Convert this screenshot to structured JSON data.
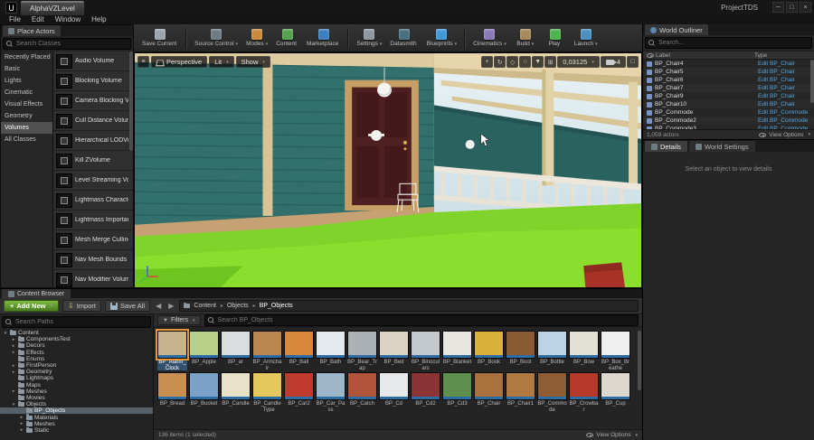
{
  "ui": {
    "caret_down": "▾",
    "crumb_sep": "▸",
    "menu_glyph": "≡",
    "close_glyph": "×",
    "min_glyph": "─",
    "max_glyph": "□",
    "back_glyph": "◀",
    "fwd_glyph": "▶",
    "plus_glyph": "+",
    "import_glyph": "⇩",
    "filter_glyph": "▼"
  },
  "window": {
    "logo": "U",
    "tab": "AlphaVZLevel",
    "title": "ProjectTDS",
    "menu": [
      "File",
      "Edit",
      "Window",
      "Help"
    ]
  },
  "place_actors": {
    "title": "Place Actors",
    "search_placeholder": "Search Classes",
    "categories": [
      "Recently Placed",
      "Basic",
      "Lights",
      "Cinematic",
      "Visual Effects",
      "Geometry",
      "Volumes",
      "All Classes"
    ],
    "selected_index": 6,
    "items": [
      "Audio Volume",
      "Blocking Volume",
      "Camera Blocking Vol",
      "Cull Distance Volume",
      "Hierarchical LODVol",
      "Kill ZVolume",
      "Level Streaming Vol",
      "Lightmass Character",
      "Lightmass Importan",
      "Mesh Merge Culling",
      "Nav Mesh Bounds V",
      "Nav Modifier Volume"
    ]
  },
  "toolbar": {
    "buttons": [
      {
        "label": "Save Current",
        "color": "#9aa5ad",
        "caret": ""
      },
      {
        "label": "Source Control",
        "color": "#6e7b84",
        "caret": "▾"
      },
      {
        "label": "Modes",
        "color": "#c98a3d",
        "caret": "▾"
      },
      {
        "label": "Content",
        "color": "#57a04e",
        "caret": ""
      },
      {
        "label": "Marketplace",
        "color": "#3e7fc1",
        "caret": ""
      },
      {
        "label": "Settings",
        "color": "#8f979e",
        "caret": "▾"
      },
      {
        "label": "Datasmith",
        "color": "#49707e",
        "caret": ""
      },
      {
        "label": "Blueprints",
        "color": "#3f9bd8",
        "caret": "▾"
      },
      {
        "label": "Cinematics",
        "color": "#8a7ab8",
        "caret": "▾"
      },
      {
        "label": "Build",
        "color": "#a68a5b",
        "caret": "▾"
      },
      {
        "label": "Play",
        "color": "#4fb34f",
        "caret": ""
      },
      {
        "label": "Launch",
        "color": "#4a90c0",
        "caret": "▾"
      }
    ]
  },
  "viewport": {
    "perspective": "Perspective",
    "lit": "Lit",
    "show": "Show",
    "grid_snap_value": "0,03125",
    "camera_speed": "4",
    "right_icons": [
      {
        "name": "move-icon",
        "glyph": "+"
      },
      {
        "name": "rotate-icon",
        "glyph": "↻"
      },
      {
        "name": "scale-icon",
        "glyph": "◇"
      },
      {
        "name": "coordinate-system-icon",
        "glyph": "○"
      },
      {
        "name": "surface-snap-icon",
        "glyph": "▼"
      },
      {
        "name": "grid-snap-icon",
        "glyph": "⊞"
      }
    ],
    "scene_colors": {
      "wall": "#31706c",
      "grass": "#7fd32a",
      "door": "#4f2022",
      "trim": "#decba0"
    }
  },
  "world_outliner": {
    "title": "World Outliner",
    "search_placeholder": "Search...",
    "columns": {
      "label": "Label",
      "type": "Type"
    },
    "rows": [
      {
        "label": "BP_Chair4",
        "type": "Edit BP_Chair"
      },
      {
        "label": "BP_Chair5",
        "type": "Edit BP_Chair"
      },
      {
        "label": "BP_Chair6",
        "type": "Edit BP_Chair"
      },
      {
        "label": "BP_Chair7",
        "type": "Edit BP_Chair"
      },
      {
        "label": "BP_Chair9",
        "type": "Edit BP_Chair"
      },
      {
        "label": "BP_Chair10",
        "type": "Edit BP_Chair"
      },
      {
        "label": "BP_Commode",
        "type": "Edit BP_Commode"
      },
      {
        "label": "BP_Commode2",
        "type": "Edit BP_Commode"
      },
      {
        "label": "BP_Commode3",
        "type": "Edit BP_Commode"
      }
    ],
    "status": "1,059 actors",
    "view_options": "View Options"
  },
  "details": {
    "tabs": [
      "Details",
      "World Settings"
    ],
    "selected_index": 0,
    "empty_text": "Select an object to view details"
  },
  "content_browser": {
    "title": "Content Browser",
    "add_new": "Add New",
    "import": "Import",
    "save_all": "Save All",
    "breadcrumbs": [
      "Content",
      "Objects",
      "BP_Objects"
    ],
    "search_paths_placeholder": "Search Paths",
    "filters_label": "Filters",
    "search_placeholder": "Search BP_Objects",
    "tree": [
      {
        "label": "Content",
        "depth": 0,
        "arrow": "▾"
      },
      {
        "label": "ComponentsTest",
        "depth": 1,
        "arrow": "▸"
      },
      {
        "label": "Decors",
        "depth": 1,
        "arrow": "▸"
      },
      {
        "label": "Effects",
        "depth": 1,
        "arrow": "▸"
      },
      {
        "label": "Enums",
        "depth": 1,
        "arrow": ""
      },
      {
        "label": "FirstPerson",
        "depth": 1,
        "arrow": "▸"
      },
      {
        "label": "Geometry",
        "depth": 1,
        "arrow": "▸"
      },
      {
        "label": "Lightmaps",
        "depth": 1,
        "arrow": ""
      },
      {
        "label": "Maps",
        "depth": 1,
        "arrow": ""
      },
      {
        "label": "Meshes",
        "depth": 1,
        "arrow": "▸"
      },
      {
        "label": "Movies",
        "depth": 1,
        "arrow": ""
      },
      {
        "label": "Objects",
        "depth": 1,
        "arrow": "▾"
      },
      {
        "label": "BP_Objects",
        "depth": 2,
        "arrow": ""
      },
      {
        "label": "Materials",
        "depth": 2,
        "arrow": "▸"
      },
      {
        "label": "Meshes",
        "depth": 2,
        "arrow": "▸"
      },
      {
        "label": "Static",
        "depth": 2,
        "arrow": "▸"
      }
    ],
    "tree_selected_index": 12,
    "assets": [
      {
        "name": "BP_Alarm_Clock",
        "color": "#c9b38c"
      },
      {
        "name": "BP_Apple",
        "color": "#b8d08a"
      },
      {
        "name": "BP_ar",
        "color": "#d9dde0"
      },
      {
        "name": "BP_Armchair",
        "color": "#b9874f"
      },
      {
        "name": "BP_Ball",
        "color": "#d8883a"
      },
      {
        "name": "BP_Bath",
        "color": "#e4ebee"
      },
      {
        "name": "BP_Bear_Trap",
        "color": "#aab2b5"
      },
      {
        "name": "BP_Bed",
        "color": "#ddd3c4"
      },
      {
        "name": "BP_Binoculars",
        "color": "#c2c8cc"
      },
      {
        "name": "BP_Blanket",
        "color": "#e8e6df"
      },
      {
        "name": "BP_Book",
        "color": "#d9b13b"
      },
      {
        "name": "BP_Boot",
        "color": "#8a5a33"
      },
      {
        "name": "BP_Bottle",
        "color": "#bcd3e6"
      },
      {
        "name": "BP_Bow",
        "color": "#e3e0d6"
      },
      {
        "name": "BP_Box_Breathe",
        "color": "#efefef"
      },
      {
        "name": "BP_Bread",
        "color": "#c98f4e"
      },
      {
        "name": "BP_Bucket",
        "color": "#7ba3c9"
      },
      {
        "name": "BP_Candle",
        "color": "#e9e2c8"
      },
      {
        "name": "BP_Candle_Type",
        "color": "#e5c95e"
      },
      {
        "name": "BP_Car2",
        "color": "#c03a30"
      },
      {
        "name": "BP_Car_Pass",
        "color": "#9db7c9"
      },
      {
        "name": "BP_Catch",
        "color": "#b2543a"
      },
      {
        "name": "BP_Cd",
        "color": "#e6e9ec"
      },
      {
        "name": "BP_Cd2",
        "color": "#8a3436"
      },
      {
        "name": "BP_Cd3",
        "color": "#5f8e4e"
      },
      {
        "name": "BP_Chair",
        "color": "#a9713d"
      },
      {
        "name": "BP_Chair1",
        "color": "#b0793f"
      },
      {
        "name": "BP_Commode",
        "color": "#8f5d33"
      },
      {
        "name": "BP_Crowbar",
        "color": "#b53a2a"
      },
      {
        "name": "BP_Cup",
        "color": "#ddd8ce"
      }
    ],
    "assets_selected_index": 0,
    "status": "136 items (1 selected)",
    "view_options": "View Options"
  }
}
